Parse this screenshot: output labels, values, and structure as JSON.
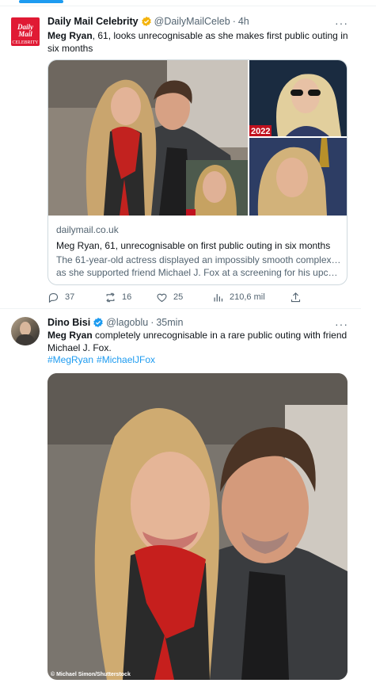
{
  "tweets": [
    {
      "author": {
        "name": "Daily Mail Celebrity",
        "handle": "@DailyMailCeleb",
        "time": "4h",
        "avatar_text": "Daily",
        "avatar_text2": "Mail",
        "avatar_text3": "CELEBRITY"
      },
      "text_bold": "Meg Ryan",
      "text_rest": ", 61, looks unrecognisable as she makes first public outing in six months",
      "card": {
        "domain": "dailymail.co.uk",
        "title": "Meg Ryan, 61, unrecognisable on first public outing in six months",
        "desc_line1": "The 61-year-old actress displayed an impossibly smooth complexion",
        "desc_line2": "as she supported friend Michael J. Fox at a screening for his upcomi...",
        "inset_label": "2022"
      },
      "stats": {
        "replies": "37",
        "retweets": "16",
        "likes": "25",
        "views": "210,6 mil"
      }
    },
    {
      "author": {
        "name": "Dino Bisi",
        "handle": "@lagoblu",
        "time": "35min"
      },
      "text_bold": "Meg Ryan",
      "text_rest": " completely unrecognisable in a rare public outing with friend Michael J. Fox.",
      "hashtags": [
        "#MegRyan",
        "#MichaelJFox"
      ],
      "photo_credit": "© Michael Simon/Shutterstock"
    }
  ],
  "colors": {
    "accent": "#1d9bf0",
    "text": "#0f1419",
    "muted": "#536471",
    "verified": "#f4b30b"
  }
}
